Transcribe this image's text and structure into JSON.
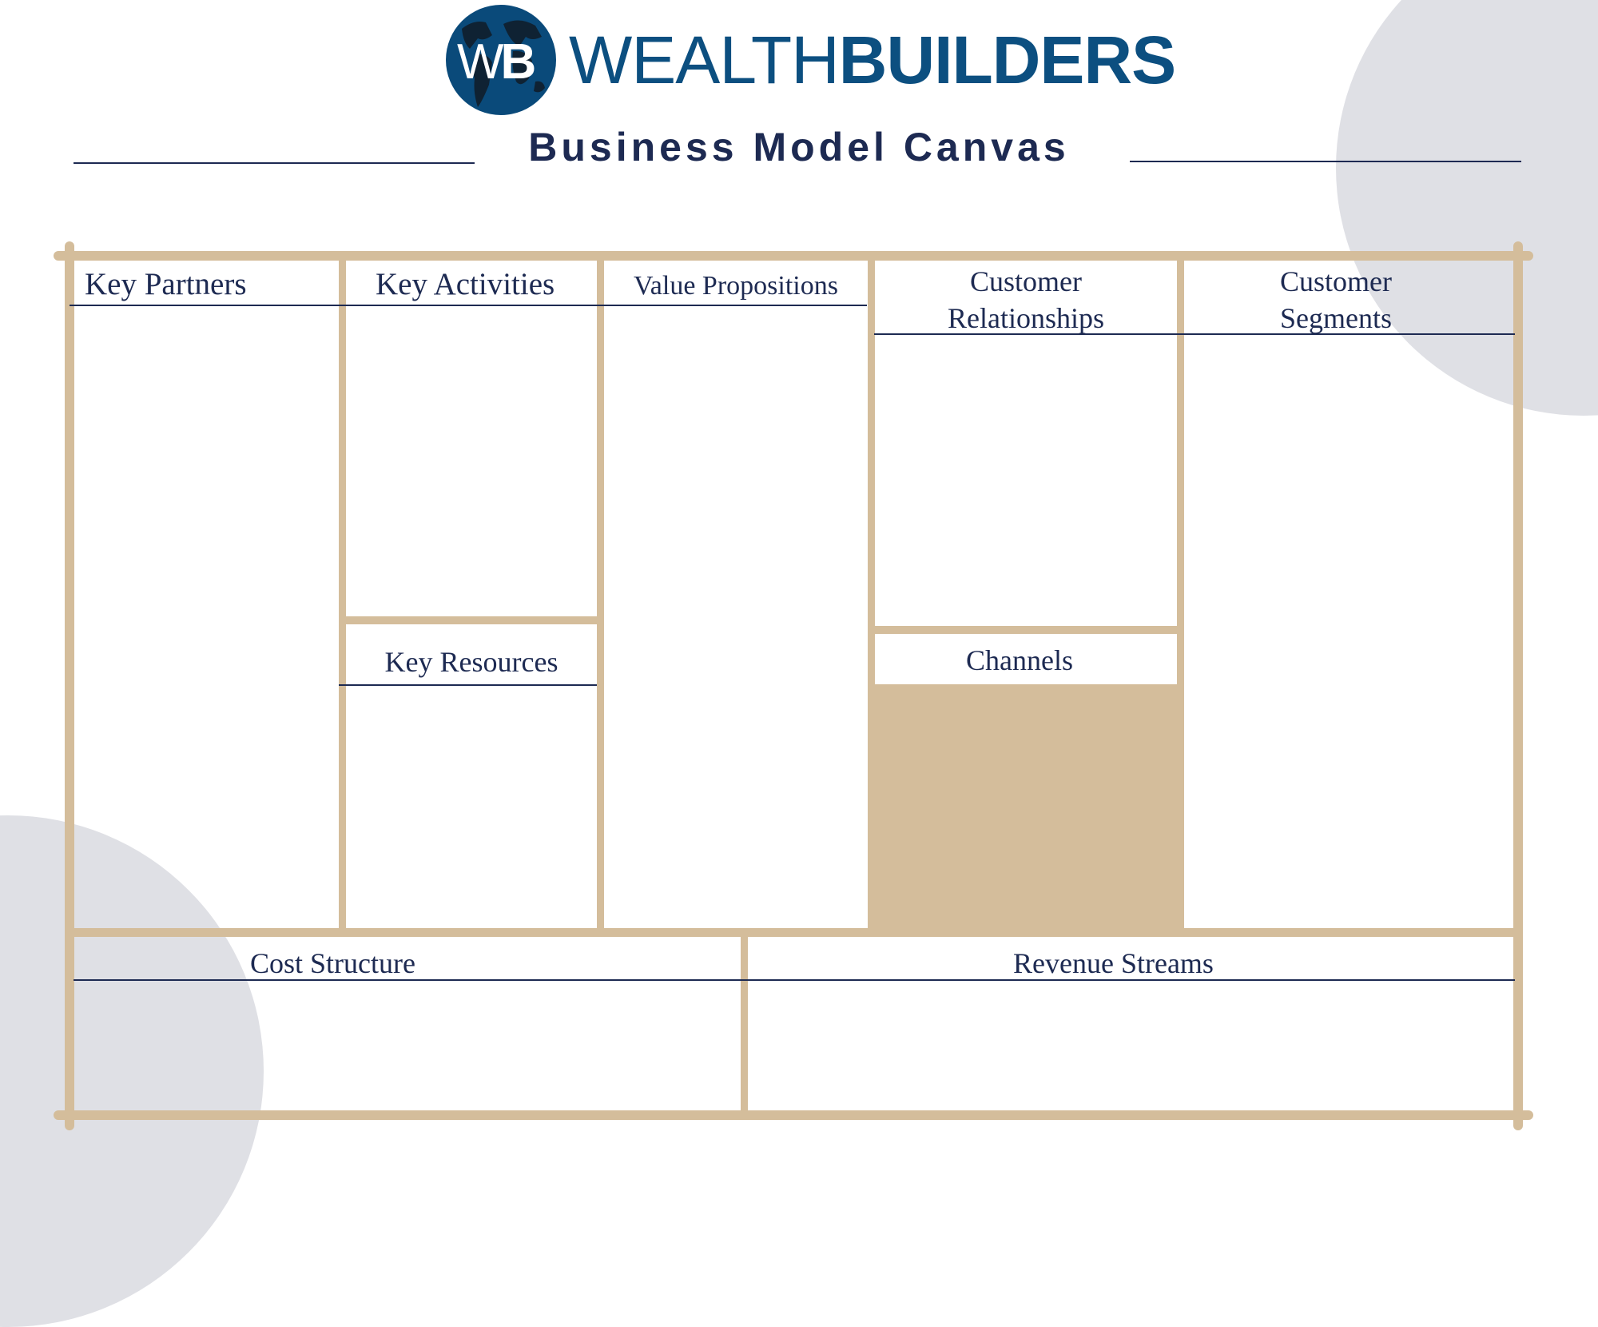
{
  "brand": {
    "monogram_light": "W",
    "monogram_bold": "B",
    "name_light": "WEALTH",
    "name_bold": "BUILDERS",
    "logo_icon": "globe-icon",
    "primary_color": "#0c4f80"
  },
  "page_title": "Business Model Canvas",
  "colors": {
    "frame": "#d4bd9b",
    "text": "#1d2a52",
    "decor_circle": "#dfe0e5",
    "channels_fill": "#d4bd9b"
  },
  "canvas": {
    "key_partners": "Key Partners",
    "key_activities": "Key Activities",
    "key_resources": "Key Resources",
    "value_propositions": "Value Propositions",
    "customer_relationships_line1": "Customer",
    "customer_relationships_line2": "Relationships",
    "channels": "Channels",
    "customer_segments_line1": "Customer",
    "customer_segments_line2": "Segments",
    "cost_structure": "Cost Structure",
    "revenue_streams": "Revenue Streams"
  }
}
